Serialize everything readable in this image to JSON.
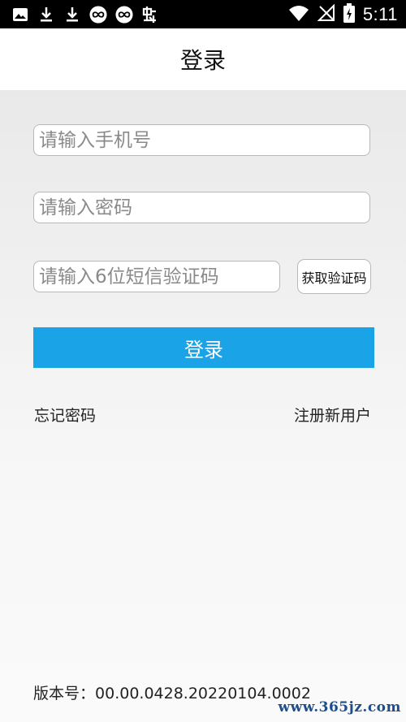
{
  "status_bar": {
    "time": "5:11",
    "left_icons": [
      "image-icon",
      "download-icon",
      "download-icon",
      "infinity-badge-icon",
      "infinity-badge-icon",
      "bug-icon"
    ],
    "right_icons": [
      "wifi-icon",
      "signal-off-icon",
      "battery-charging-icon"
    ]
  },
  "header": {
    "title": "登录"
  },
  "form": {
    "phone_placeholder": "请输入手机号",
    "password_placeholder": "请输入密码",
    "code_placeholder": "请输入6位短信验证码",
    "get_code_label": "获取验证码",
    "login_label": "登录"
  },
  "links": {
    "forgot_password": "忘记密码",
    "register": "注册新用户"
  },
  "footer": {
    "version_label": "版本号：",
    "version_value": "00.00.0428.20220104.0002",
    "watermark": "www.365jz.com"
  },
  "colors": {
    "accent": "#1aa3e6",
    "status_bar": "#000000",
    "header_bg": "#ffffff",
    "watermark": "#1d4e8a"
  }
}
